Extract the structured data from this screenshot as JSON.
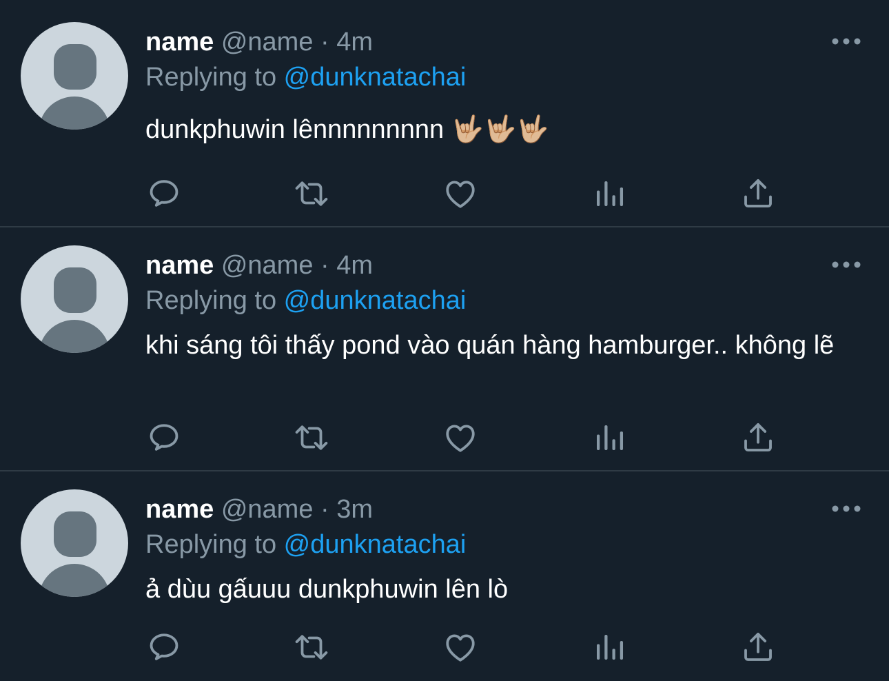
{
  "tweets": [
    {
      "name": "name",
      "handle": "@name",
      "separator": "·",
      "time": "4m",
      "reply_prefix": "Replying to ",
      "reply_handle": "@dunknatachai",
      "text": "dunkphuwin lênnnnnnnnn 🤟🏼🤟🏼🤟🏼"
    },
    {
      "name": "name",
      "handle": "@name",
      "separator": "·",
      "time": "4m",
      "reply_prefix": "Replying to ",
      "reply_handle": "@dunknatachai",
      "text": "khi sáng tôi thấy pond vào quán hàng hamburger.. không lẽ"
    },
    {
      "name": "name",
      "handle": "@name",
      "separator": "·",
      "time": "3m",
      "reply_prefix": "Replying to ",
      "reply_handle": "@dunknatachai",
      "text": "ả dùu gấuuu dunkphuwin lên lò"
    }
  ],
  "icons": {
    "avatar": "default-avatar-icon",
    "more": "more-options-icon",
    "reply": "reply-icon",
    "retweet": "retweet-icon",
    "like": "like-icon",
    "stats": "analytics-icon",
    "share": "share-icon"
  },
  "colors": {
    "background": "#15202b",
    "text": "#ffffff",
    "secondary": "#8899a6",
    "link": "#1da1f2",
    "divider": "#2f3b45",
    "avatar_bg": "#ccd6dd",
    "avatar_fg": "#66757f"
  }
}
